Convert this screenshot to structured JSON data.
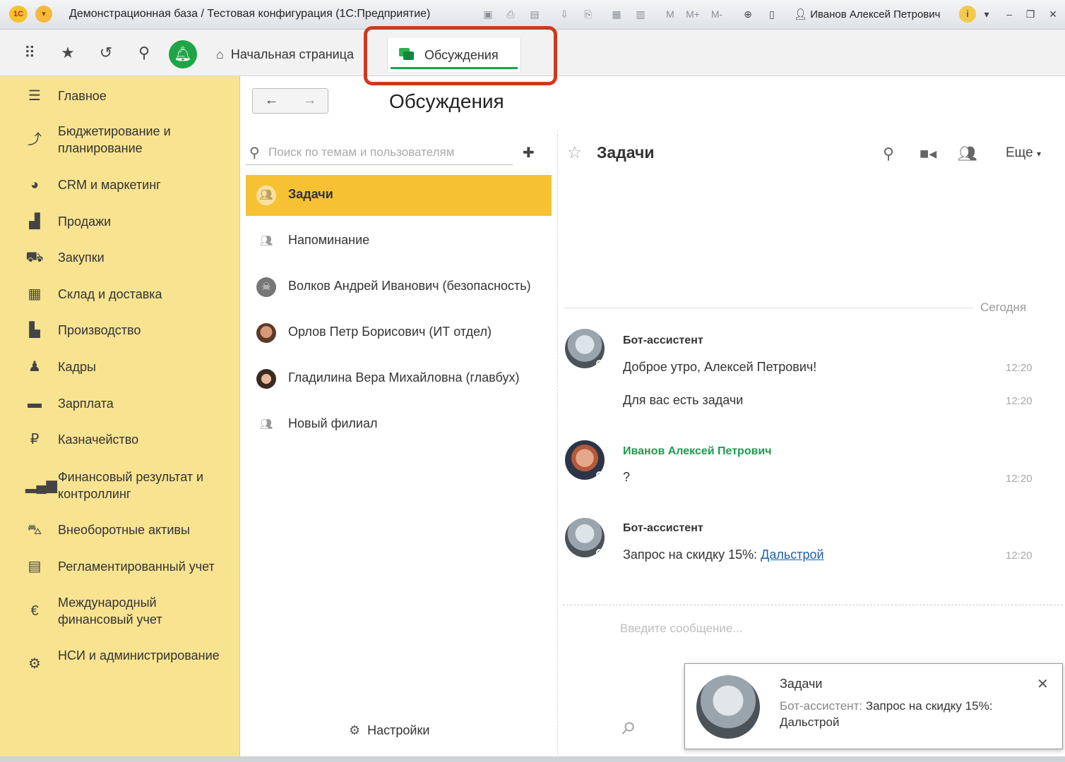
{
  "window": {
    "title": "Демонстрационная база / Тестовая конфигурация  (1С:Предприятие)",
    "logo": "1С",
    "user": "Иванов Алексей Петрович",
    "mem_buttons": [
      "M",
      "M+",
      "M-"
    ],
    "info": "i"
  },
  "toolbar": {
    "tabs": [
      {
        "label": "Начальная страница",
        "icon": "home-icon"
      },
      {
        "label": "Обсуждения",
        "icon": "chat-icon"
      }
    ]
  },
  "sidebar": {
    "items": [
      {
        "label": "Главное",
        "icon": "menu-icon"
      },
      {
        "label": "Бюджетирование и планирование",
        "icon": "budget-icon"
      },
      {
        "label": "CRM и маркетинг",
        "icon": "crm-icon"
      },
      {
        "label": "Продажи",
        "icon": "bag-icon"
      },
      {
        "label": "Закупки",
        "icon": "cart-icon"
      },
      {
        "label": "Склад и доставка",
        "icon": "warehouse-icon"
      },
      {
        "label": "Производство",
        "icon": "factory-icon"
      },
      {
        "label": "Кадры",
        "icon": "person-icon"
      },
      {
        "label": "Зарплата",
        "icon": "wallet-icon"
      },
      {
        "label": "Казначейство",
        "icon": "ruble-icon"
      },
      {
        "label": "Финансовый результат и контроллинг",
        "icon": "bar-chart-icon"
      },
      {
        "label": "Внеоборотные активы",
        "icon": "car-icon"
      },
      {
        "label": "Регламентированный учет",
        "icon": "calculator-icon"
      },
      {
        "label": "Международный финансовый учет",
        "icon": "euro-icon"
      },
      {
        "label": "НСИ и администрирование",
        "icon": "gear-icon"
      }
    ]
  },
  "discussions": {
    "page_title": "Обсуждения",
    "search_placeholder": "Поиск по темам и пользователям",
    "items": [
      {
        "name": "Задачи",
        "active": true
      },
      {
        "name": "Напоминание",
        "active": false
      },
      {
        "name": "Волков Андрей Иванович (безопасность)",
        "active": false
      },
      {
        "name": "Орлов Петр Борисович (ИТ отдел)",
        "active": false
      },
      {
        "name": "Гладилина Вера Михайловна (главбух)",
        "active": false
      },
      {
        "name": "Новый филиал",
        "active": false
      }
    ],
    "settings_label": "Настройки"
  },
  "chat": {
    "title": "Задачи",
    "more_label": "Еще",
    "day_label": "Сегодня",
    "messages": [
      {
        "sender": "Бот-ассистент",
        "lines": [
          {
            "text": "Доброе утро, Алексей Петрович!",
            "time": "12:20"
          },
          {
            "text": "Для вас есть задачи",
            "time": "12:20"
          }
        ]
      },
      {
        "sender": "Иванов Алексей Петрович",
        "lines": [
          {
            "text": "?",
            "time": "12:20"
          }
        ]
      },
      {
        "sender": "Бот-ассистент",
        "lines": [
          {
            "text": "Запрос на скидку 15%: ",
            "link": "Дальстрой",
            "time": "12:20"
          }
        ]
      }
    ],
    "input_placeholder": "Введите сообщение..."
  },
  "notification": {
    "title": "Задачи",
    "sender": "Бот-ассистент:",
    "text": "Запрос на скидку 15%: Дальстрой"
  },
  "colors": {
    "sidebar_bg": "#f8e391",
    "active_item": "#f6c234",
    "accent_green": "#1fa548",
    "highlight": "#cc3a1e",
    "link": "#1f5fb3"
  }
}
